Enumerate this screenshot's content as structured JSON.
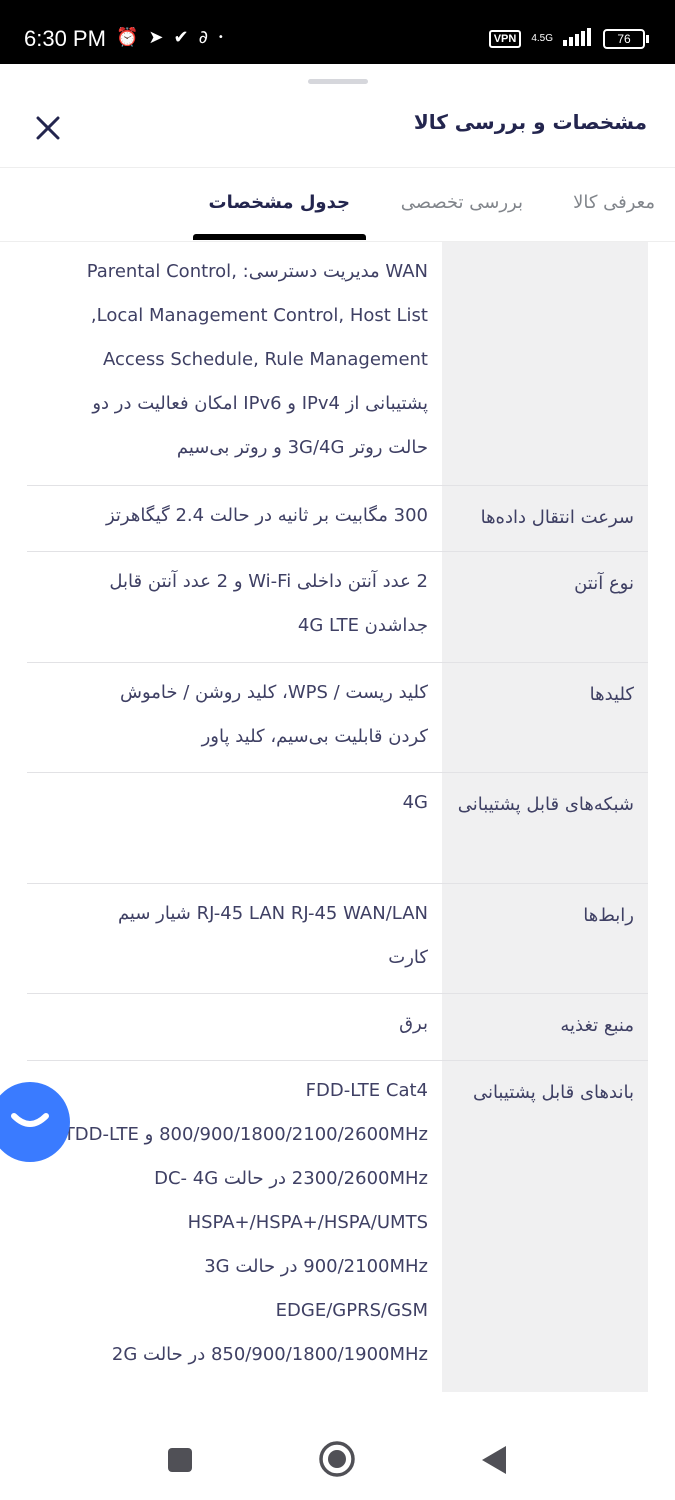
{
  "status_bar": {
    "time": "6:30 PM",
    "vpn": "VPN",
    "network": "4.5G",
    "battery": "76"
  },
  "sheet": {
    "title": "مشخصات و بررسی کالا"
  },
  "tabs": [
    {
      "label": "معرفی کالا",
      "active": false
    },
    {
      "label": "بررسی تخصصی",
      "active": false
    },
    {
      "label": "جدول مشخصات",
      "active": true
    }
  ],
  "specs": [
    {
      "key": "",
      "lines": [
        "WAN مدیریت دسترسی: ,Parental Control",
        "Local Management Control, Host List,",
        "Access Schedule, Rule Management",
        "پشتیبانی از IPv4 و IPv6 امکان فعالیت در دو",
        "حالت روتر 3G/4G و روتر بی‌سیم"
      ]
    },
    {
      "key": "سرعت انتقال داده‌ها",
      "lines": [
        "300 مگابیت بر ثانیه در حالت 2.4 گیگاهرتز"
      ]
    },
    {
      "key": "نوع آنتن",
      "lines": [
        "2 عدد آنتن داخلی Wi-Fi و 2 عدد آنتن قابل",
        "جداشدن 4G LTE"
      ]
    },
    {
      "key": "کلیدها",
      "lines": [
        "کلید ریست / WPS، کلید روشن / خاموش",
        "کردن قابلیت بی‌سیم، کلید پاور"
      ]
    },
    {
      "key": "شبکه‌های قابل پشتیبانی",
      "lines": [
        "4G"
      ]
    },
    {
      "key": "رابط‌ها",
      "lines": [
        "RJ-45 LAN RJ-45 WAN/LAN شیار سیم",
        "کارت"
      ]
    },
    {
      "key": "منبع تغذیه",
      "lines": [
        "برق"
      ]
    },
    {
      "key": "باندهای قابل پشتیبانی",
      "lines": [
        "FDD-LTE Cat4",
        "800/900/1800/2100/2600MHz و TDD-LTE",
        "2300/2600MHz در حالت DC- 4G",
        "HSPA+/HSPA+/HSPA/UMTS",
        "900/2100MHz در حالت 3G",
        "EDGE/GPRS/GSM",
        "850/900/1800/1900MHz در حالت 2G"
      ]
    }
  ],
  "colors": {
    "text": "#3f4064",
    "title": "#23254e",
    "muted_tab": "#81858b",
    "key_bg": "#f0f0f1",
    "chat_fab": "#3a7bff"
  },
  "icons": {
    "close": "close-icon",
    "chat": "chat-smile-icon",
    "nav_recents": "square-icon",
    "nav_home": "circle-icon",
    "nav_back": "triangle-back-icon"
  }
}
